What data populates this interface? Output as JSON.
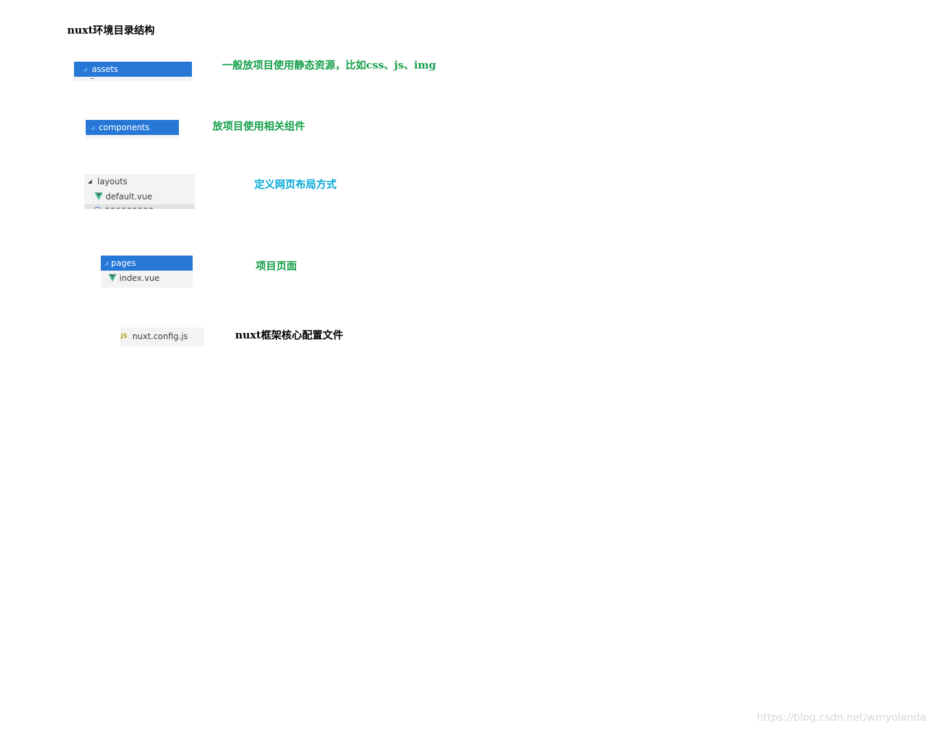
{
  "page": {
    "title": "nuxt环境目录结构"
  },
  "sections": [
    {
      "folder": "assets",
      "description": "一般放项目使用静态资源，比如css、js、img",
      "description_color": "#15a04a"
    },
    {
      "folder": "components",
      "description": "放项目使用相关组件",
      "description_color": "#15a04a"
    },
    {
      "folder": "layouts",
      "child": "default.vue",
      "description": "定义网页布局方式",
      "description_color": "#00a8d6"
    },
    {
      "folder": "pages",
      "child": "index.vue",
      "description": "项目页面",
      "description_color": "#15a04a"
    },
    {
      "file": "nuxt.config.js",
      "file_icon": "JS",
      "description": "nuxt框架核心配置文件",
      "description_color": "#000000"
    }
  ],
  "colors": {
    "selection": "#2778d6",
    "tree_background": "#f3f3f3",
    "vue_icon_green": "#41b883",
    "js_icon_yellow": "#b7a11c"
  },
  "icons": {
    "folder_arrow": "chevron-down-icon",
    "vue_file": "vue-icon",
    "js_file": "js-file-icon"
  },
  "watermark": "https://blog.csdn.net/wmyolanda"
}
